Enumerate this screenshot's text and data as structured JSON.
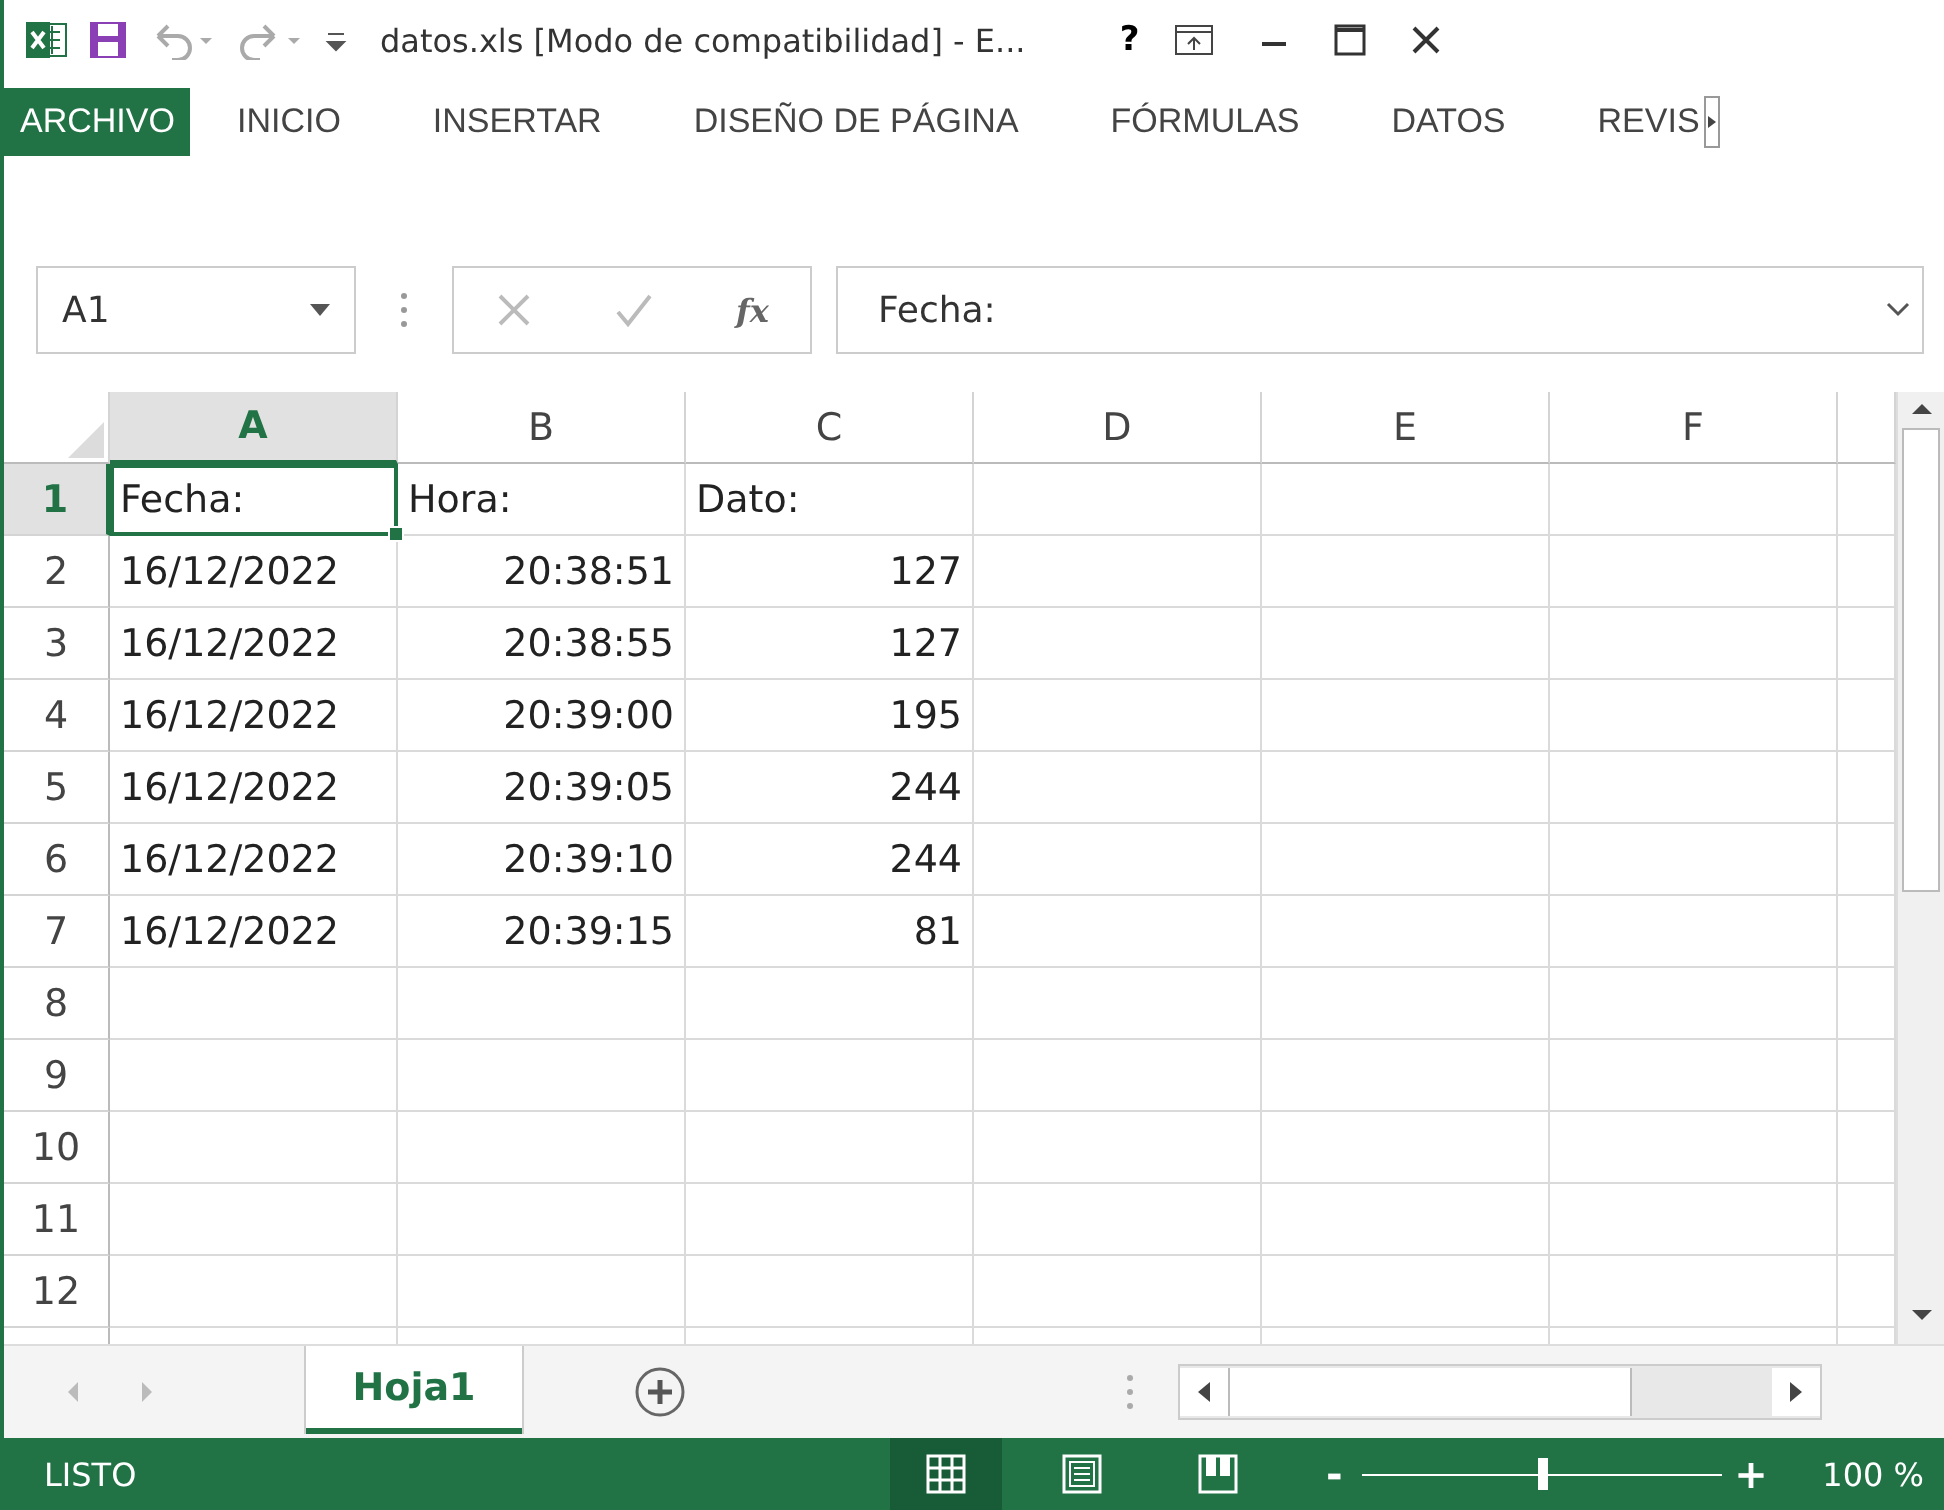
{
  "window": {
    "title": "datos.xls  [Modo de compatibilidad] - E...",
    "help": "?"
  },
  "ribbon_tabs": [
    {
      "label": "ARCHIVO",
      "selected": true
    },
    {
      "label": "INICIO",
      "selected": false
    },
    {
      "label": "INSERTAR",
      "selected": false
    },
    {
      "label": "DISEÑO DE PÁGINA",
      "selected": false
    },
    {
      "label": "FÓRMULAS",
      "selected": false
    },
    {
      "label": "DATOS",
      "selected": false
    },
    {
      "label": "REVIS",
      "selected": false
    }
  ],
  "formula_bar": {
    "name_box": "A1",
    "fx": "fx",
    "value": "Fecha:"
  },
  "columns": [
    {
      "label": "A",
      "selected": true
    },
    {
      "label": "B",
      "selected": false
    },
    {
      "label": "C",
      "selected": false
    },
    {
      "label": "D",
      "selected": false
    },
    {
      "label": "E",
      "selected": false
    },
    {
      "label": "F",
      "selected": false
    }
  ],
  "rows": [
    {
      "label": "1",
      "selected": true,
      "cells": [
        "Fecha:",
        "Hora:",
        "Dato:"
      ]
    },
    {
      "label": "2",
      "selected": false,
      "cells": [
        "16/12/2022",
        "20:38:51",
        "127"
      ]
    },
    {
      "label": "3",
      "selected": false,
      "cells": [
        "16/12/2022",
        "20:38:55",
        "127"
      ]
    },
    {
      "label": "4",
      "selected": false,
      "cells": [
        "16/12/2022",
        "20:39:00",
        "195"
      ]
    },
    {
      "label": "5",
      "selected": false,
      "cells": [
        "16/12/2022",
        "20:39:05",
        "244"
      ]
    },
    {
      "label": "6",
      "selected": false,
      "cells": [
        "16/12/2022",
        "20:39:10",
        "244"
      ]
    },
    {
      "label": "7",
      "selected": false,
      "cells": [
        "16/12/2022",
        "20:39:15",
        "81"
      ]
    },
    {
      "label": "8",
      "selected": false,
      "cells": []
    },
    {
      "label": "9",
      "selected": false,
      "cells": []
    },
    {
      "label": "10",
      "selected": false,
      "cells": []
    },
    {
      "label": "11",
      "selected": false,
      "cells": []
    },
    {
      "label": "12",
      "selected": false,
      "cells": []
    }
  ],
  "sheet_tabs": [
    {
      "label": "Hoja1",
      "selected": true
    }
  ],
  "status_bar": {
    "status": "LISTO",
    "views": [
      {
        "kind": "normal",
        "selected": true
      },
      {
        "kind": "layout",
        "selected": false
      },
      {
        "kind": "pagebreak",
        "selected": false
      }
    ],
    "zoom": {
      "level": 0.5,
      "minus": "-",
      "plus": "+",
      "reading": "100 %"
    }
  }
}
